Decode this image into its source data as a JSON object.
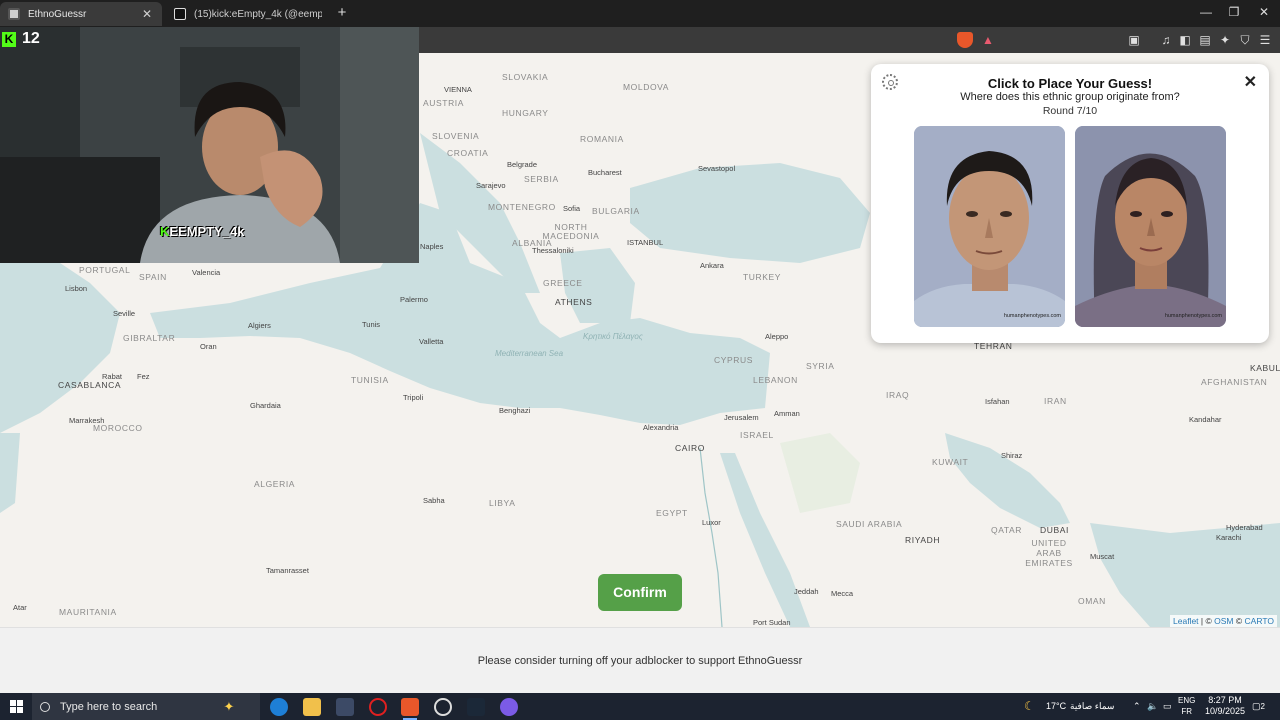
{
  "browser": {
    "tabs": [
      {
        "title": "EthnoGuessr",
        "active": true
      },
      {
        "title": "(15)kick:eEmpty_4k (@eempty_8k) | T",
        "active": false
      }
    ],
    "shield_count": "1",
    "rewards_count": "1"
  },
  "map": {
    "countries": [
      "SLOVAKIA",
      "AUSTRIA",
      "HUNGARY",
      "MOLDOVA",
      "ROMANIA",
      "SLOVENIA",
      "CROATIA",
      "SERBIA",
      "MONTENEGRO",
      "BULGARIA",
      "NORTH MACEDONIA",
      "ALBANIA",
      "PORTUGAL",
      "SPAIN",
      "GREECE",
      "TURKEY",
      "CYPRUS",
      "SYRIA",
      "LEBANON",
      "TUNISIA",
      "MOROCCO",
      "ALGERIA",
      "LIBYA",
      "EGYPT",
      "ISRAEL",
      "IRAQ",
      "IRAN",
      "AFGHANISTAN",
      "KUWAIT",
      "SAUDI ARABIA",
      "QATAR",
      "UNITED ARAB EMIRATES",
      "OMAN",
      "MAURITANIA",
      "GIBRALTAR",
      "CASABLANCA",
      "ATHENS",
      "CAIRO",
      "TEHRAN",
      "RIYADH",
      "DUBAI",
      "KABUL"
    ],
    "cities": [
      "VIENNA",
      "Belgrade",
      "Sarajevo",
      "Bucharest",
      "Sevastopol",
      "Sofia",
      "Thessaloniki",
      "ISTANBUL",
      "Ankara",
      "Naples",
      "Valencia",
      "Lisbon",
      "Palermo",
      "Algiers",
      "Tunis",
      "Seville",
      "Oran",
      "Valletta",
      "Aleppo",
      "Rabat",
      "Fez",
      "Ghardaia",
      "Tripoli",
      "Benghazi",
      "Alexandria",
      "Jerusalem",
      "Amman",
      "Marrakesh",
      "Isfahan",
      "Kandahar",
      "Shiraz",
      "Sabha",
      "Luxor",
      "Hyderabad",
      "Karachi",
      "Muscat",
      "Tamanrasset",
      "Jeddah",
      "Mecca",
      "Atar",
      "Port Sudan"
    ],
    "seas": [
      "Mediterranean Sea",
      "Κρητικό Πέλαγος"
    ],
    "attribution": {
      "leaflet": "Leaflet",
      "sep": "|",
      "osm": "OSM",
      "carto": "CARTO",
      "copy": "©"
    },
    "colors": {
      "land": "#f4f2ee",
      "water": "#cbdfe0",
      "pin": "#1a1ad8",
      "confirm": "#55a048"
    }
  },
  "panel": {
    "title": "Click to Place Your Guess!",
    "question": "Where does this ethnic group originate from?",
    "round": "Round 7/10",
    "watermark": "humanphenotypes.com"
  },
  "confirm_label": "Confirm",
  "stream": {
    "viewers": "12",
    "handle": "EEMPTY_4k"
  },
  "footer_text": "Please consider turning off your adblocker to support EthnoGuessr",
  "taskbar": {
    "search_placeholder": "Type here to search",
    "temperature": "17°C",
    "weather": "سماء صافية",
    "lang_top": "ENG",
    "lang_bottom": "FR",
    "time": "8:27 PM",
    "date": "10/9/2025",
    "notifications": "2"
  }
}
